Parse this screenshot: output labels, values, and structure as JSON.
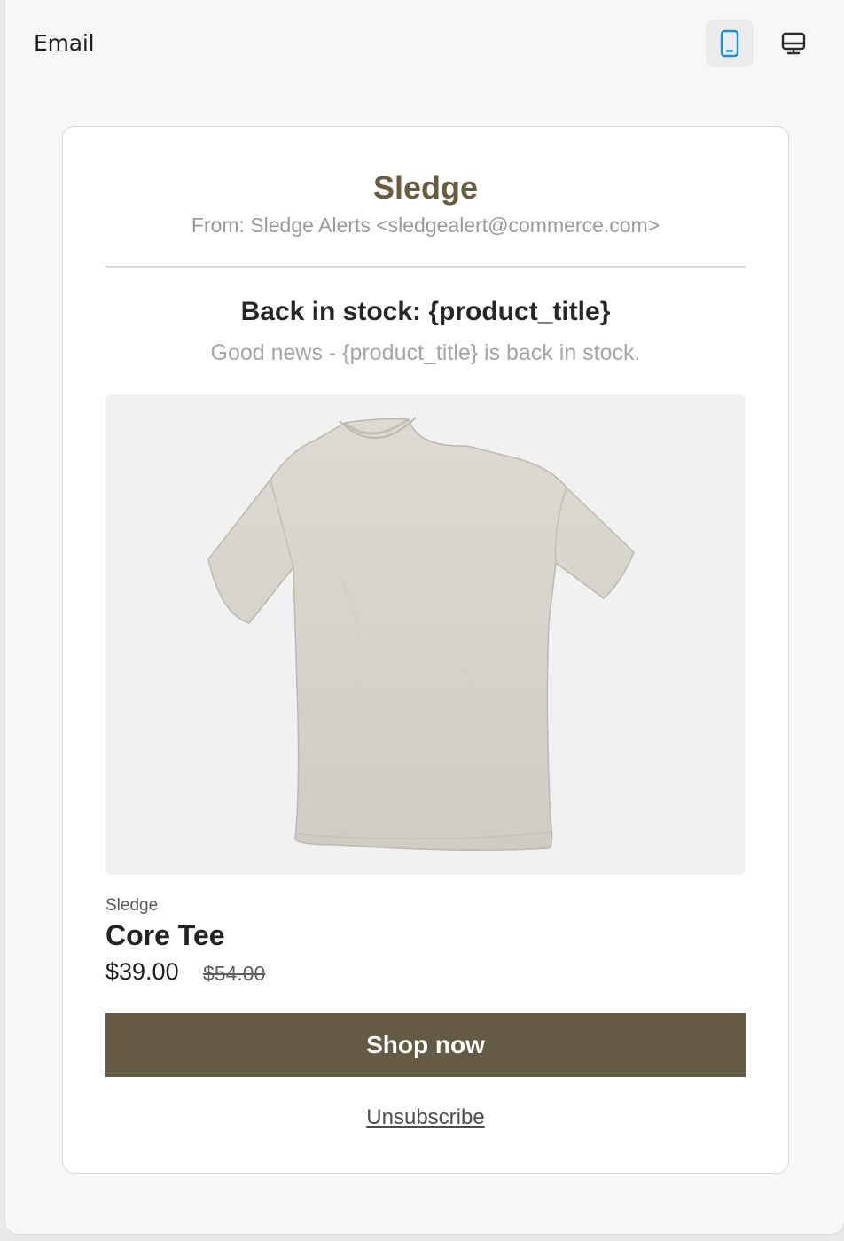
{
  "header": {
    "title": "Email",
    "view_toggle": {
      "mobile_icon": "mobile-phone-icon",
      "desktop_icon": "desktop-monitor-icon",
      "active": "mobile",
      "active_color": "#1592d0"
    }
  },
  "email": {
    "brand_name": "Sledge",
    "from_line": "From: Sledge Alerts <sledgealert@commerce.com>",
    "headline": "Back in stock: {product_title}",
    "subtext": "Good news - {product_title} is back in stock.",
    "product": {
      "vendor": "Sledge",
      "title": "Core Tee",
      "price": "$39.00",
      "compare_at_price": "$54.00"
    },
    "cta_label": "Shop now",
    "unsubscribe_label": "Unsubscribe"
  },
  "colors": {
    "brand": "#6b5b3e",
    "button": "#655a43",
    "mobile_active": "#1592d0"
  }
}
